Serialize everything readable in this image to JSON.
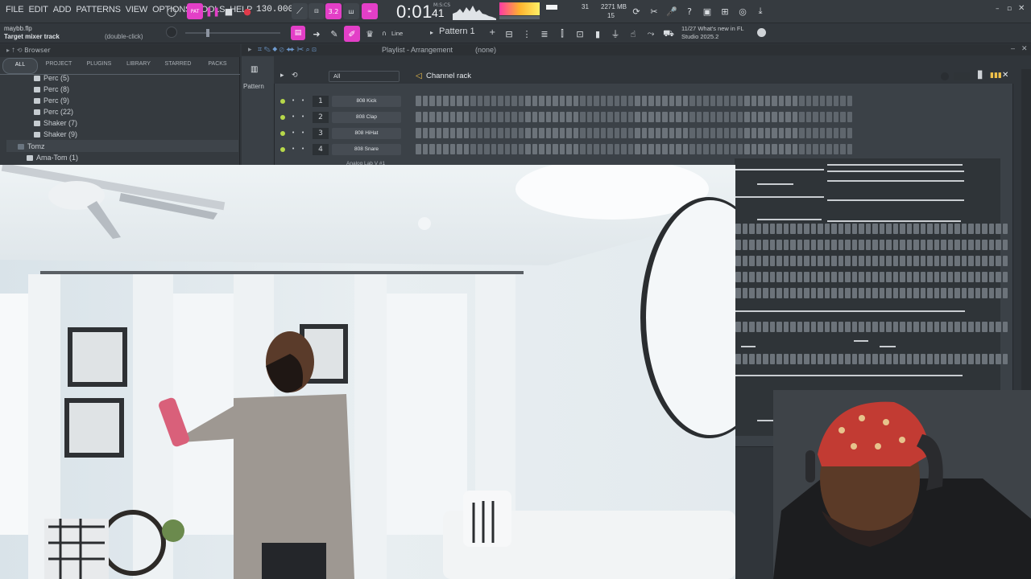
{
  "app": {
    "menu": [
      "FILE",
      "EDIT",
      "ADD",
      "PATTERNS",
      "VIEW",
      "OPTIONS",
      "TOOLS",
      "HELP"
    ],
    "tempo": "130.000",
    "clock": "0:01",
    "clock_sub": "41",
    "clock_label": "M:S:CS",
    "cpu_val": "31",
    "mem": "2271 MB",
    "poly": "15",
    "accent_color": "#e33fc7"
  },
  "toolbar2": {
    "file_name": "maybb.flp",
    "hint": "Target mixer track",
    "hint_action": "(double-click)",
    "snap": "Line",
    "pattern": "Pattern 1",
    "news_date": "11/27",
    "news_title": "What's new in FL",
    "news_sub": "Studio 2025.2"
  },
  "browser": {
    "title": "Browser",
    "tabs": [
      "ALL",
      "PROJECT",
      "PLUGINS",
      "LIBRARY",
      "STARRED",
      "PACKS"
    ],
    "items": [
      "Perc (5)",
      "Perc (8)",
      "Perc (9)",
      "Perc (22)",
      "Shaker (7)",
      "Shaker (9)"
    ],
    "folder": "Tomz",
    "subfolder": "Ama-Tom (1)"
  },
  "playlist": {
    "title": "Playlist - Arrangement",
    "selection": "(none)",
    "side_label": "Pattern"
  },
  "channel_rack": {
    "title": "Channel rack",
    "filter": "All",
    "channels": [
      {
        "num": "1",
        "name": "808 Kick"
      },
      {
        "num": "2",
        "name": "808 Clap"
      },
      {
        "num": "3",
        "name": "808 HiHat"
      },
      {
        "num": "4",
        "name": "808 Snare"
      }
    ],
    "partial_channel": "Analog Lab V #1"
  }
}
